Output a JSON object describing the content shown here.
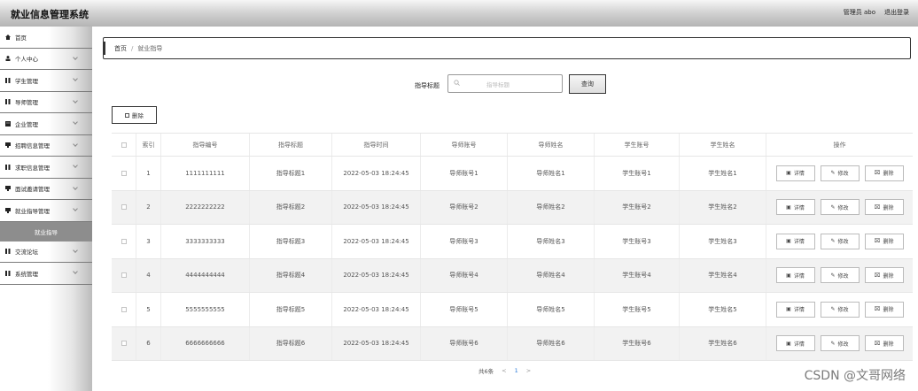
{
  "header": {
    "app_title": "就业信息管理系统",
    "user_label": "管理员 abo",
    "logout_label": "退出登录"
  },
  "sidebar": {
    "items": [
      {
        "label": "首页",
        "icon": "home-icon",
        "has_children": false
      },
      {
        "label": "个人中心",
        "icon": "person-icon",
        "has_children": true
      },
      {
        "label": "学生管理",
        "icon": "grid-icon",
        "has_children": true
      },
      {
        "label": "导师管理",
        "icon": "grid-icon",
        "has_children": true
      },
      {
        "label": "企业管理",
        "icon": "building-icon",
        "has_children": true
      },
      {
        "label": "招聘信息管理",
        "icon": "doc-icon",
        "has_children": true
      },
      {
        "label": "求职信息管理",
        "icon": "grid-icon",
        "has_children": true
      },
      {
        "label": "面试邀请管理",
        "icon": "doc-icon",
        "has_children": true
      },
      {
        "label": "就业指导管理",
        "icon": "doc-icon",
        "has_children": true
      }
    ],
    "active_submenu": "就业指导",
    "items_after": [
      {
        "label": "交流论坛",
        "icon": "grid-icon",
        "has_children": true
      },
      {
        "label": "系统管理",
        "icon": "grid-icon",
        "has_children": true
      }
    ]
  },
  "breadcrumb": {
    "home": "首页",
    "separator": "/",
    "current": "就业指导"
  },
  "search": {
    "label": "指导标题",
    "placeholder": "指导标题",
    "button_label": "查询"
  },
  "batch_delete_label": "删除",
  "table": {
    "headers": [
      "索引",
      "指导编号",
      "指导标题",
      "指导时间",
      "导师账号",
      "导师姓名",
      "学生账号",
      "学生姓名",
      "操作"
    ],
    "rows": [
      {
        "index": "1",
        "code": "1111111111",
        "title": "指导标题1",
        "time": "2022-05-03 18:24:45",
        "tutor_account": "导师账号1",
        "tutor_name": "导师姓名1",
        "student_account": "学生账号1",
        "student_name": "学生姓名1"
      },
      {
        "index": "2",
        "code": "2222222222",
        "title": "指导标题2",
        "time": "2022-05-03 18:24:45",
        "tutor_account": "导师账号2",
        "tutor_name": "导师姓名2",
        "student_account": "学生账号2",
        "student_name": "学生姓名2"
      },
      {
        "index": "3",
        "code": "3333333333",
        "title": "指导标题3",
        "time": "2022-05-03 18:24:45",
        "tutor_account": "导师账号3",
        "tutor_name": "导师姓名3",
        "student_account": "学生账号3",
        "student_name": "学生姓名3"
      },
      {
        "index": "4",
        "code": "4444444444",
        "title": "指导标题4",
        "time": "2022-05-03 18:24:45",
        "tutor_account": "导师账号4",
        "tutor_name": "导师姓名4",
        "student_account": "学生账号4",
        "student_name": "学生姓名4"
      },
      {
        "index": "5",
        "code": "5555555555",
        "title": "指导标题5",
        "time": "2022-05-03 18:24:45",
        "tutor_account": "导师账号5",
        "tutor_name": "导师姓名5",
        "student_account": "学生账号5",
        "student_name": "学生姓名5"
      },
      {
        "index": "6",
        "code": "6666666666",
        "title": "指导标题6",
        "time": "2022-05-03 18:24:45",
        "tutor_account": "导师账号6",
        "tutor_name": "导师姓名6",
        "student_account": "学生账号6",
        "student_name": "学生姓名6"
      }
    ],
    "actions": {
      "detail": "详情",
      "edit": "修改",
      "delete": "删除"
    }
  },
  "pagination": {
    "total_label": "共6条",
    "prev": "<",
    "current_page": "1",
    "next": ">"
  },
  "watermark": "CSDN @文哥网络"
}
